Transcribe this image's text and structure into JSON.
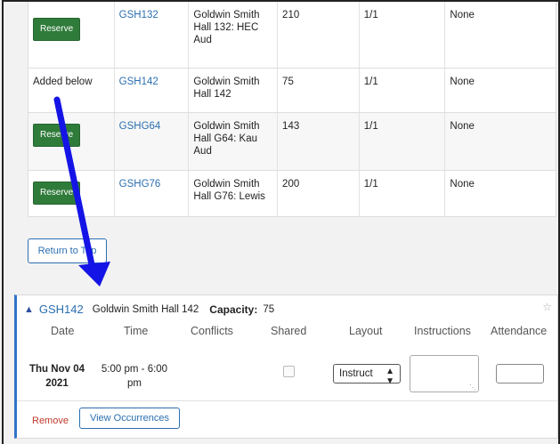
{
  "rooms": [
    {
      "action": "Reserve",
      "action_type": "button",
      "code": "GSH132",
      "name": "Goldwin Smith Hall 132: HEC Aud",
      "capacity": "210",
      "ratio": "1/1",
      "features": "None"
    },
    {
      "action": "Added below",
      "action_type": "text",
      "code": "GSH142",
      "name": "Goldwin Smith Hall 142",
      "capacity": "75",
      "ratio": "1/1",
      "features": "None"
    },
    {
      "action": "Reserve",
      "action_type": "button",
      "code": "GSHG64",
      "name": "Goldwin Smith Hall G64: Kau Aud",
      "capacity": "143",
      "ratio": "1/1",
      "features": "None"
    },
    {
      "action": "Reserve",
      "action_type": "button",
      "code": "GSHG76",
      "name": "Goldwin Smith Hall G76: Lewis",
      "capacity": "200",
      "ratio": "1/1",
      "features": "None"
    }
  ],
  "return_label": "Return to Top",
  "panel": {
    "code": "GSH142",
    "name": "Goldwin Smith Hall 142",
    "capacity_label": "Capacity:",
    "capacity_value": "75",
    "headers": [
      "Date",
      "Time",
      "Conflicts",
      "Shared",
      "Layout",
      "Instructions",
      "Attendance"
    ],
    "date_line1": "Thu Nov 04",
    "date_line2": "2021",
    "time_line1": "5:00 pm - 6:00",
    "time_line2": "pm",
    "layout_value": "Instruct",
    "remove_label": "Remove",
    "view_label": "View Occurrences"
  },
  "colors": {
    "accent": "#2b6fb0",
    "reserve_green": "#2f7b3a",
    "arrow": "#1414e6",
    "remove_red": "#c0392b"
  }
}
